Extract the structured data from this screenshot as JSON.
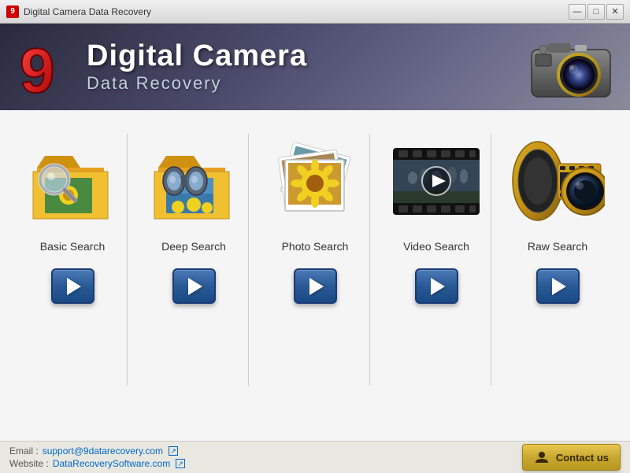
{
  "window": {
    "title": "Digital Camera Data Recovery",
    "controls": {
      "minimize": "—",
      "maximize": "□",
      "close": "✕"
    }
  },
  "header": {
    "main_title": "Digital Camera",
    "sub_title": "Data Recovery",
    "logo_number": "9"
  },
  "search_options": [
    {
      "id": "basic",
      "label": "Basic Search",
      "icon_type": "folder-magnify"
    },
    {
      "id": "deep",
      "label": "Deep Search",
      "icon_type": "folder-binoculars"
    },
    {
      "id": "photo",
      "label": "Photo Search",
      "icon_type": "photos-stack"
    },
    {
      "id": "video",
      "label": "Video Search",
      "icon_type": "film-play"
    },
    {
      "id": "raw",
      "label": "Raw Search",
      "icon_type": "film-camera"
    }
  ],
  "footer": {
    "email_label": "Email :",
    "email_value": "support@9datarecovery.com",
    "website_label": "Website :",
    "website_value": "DataRecoverySoftware.com",
    "contact_button": "Contact us"
  }
}
